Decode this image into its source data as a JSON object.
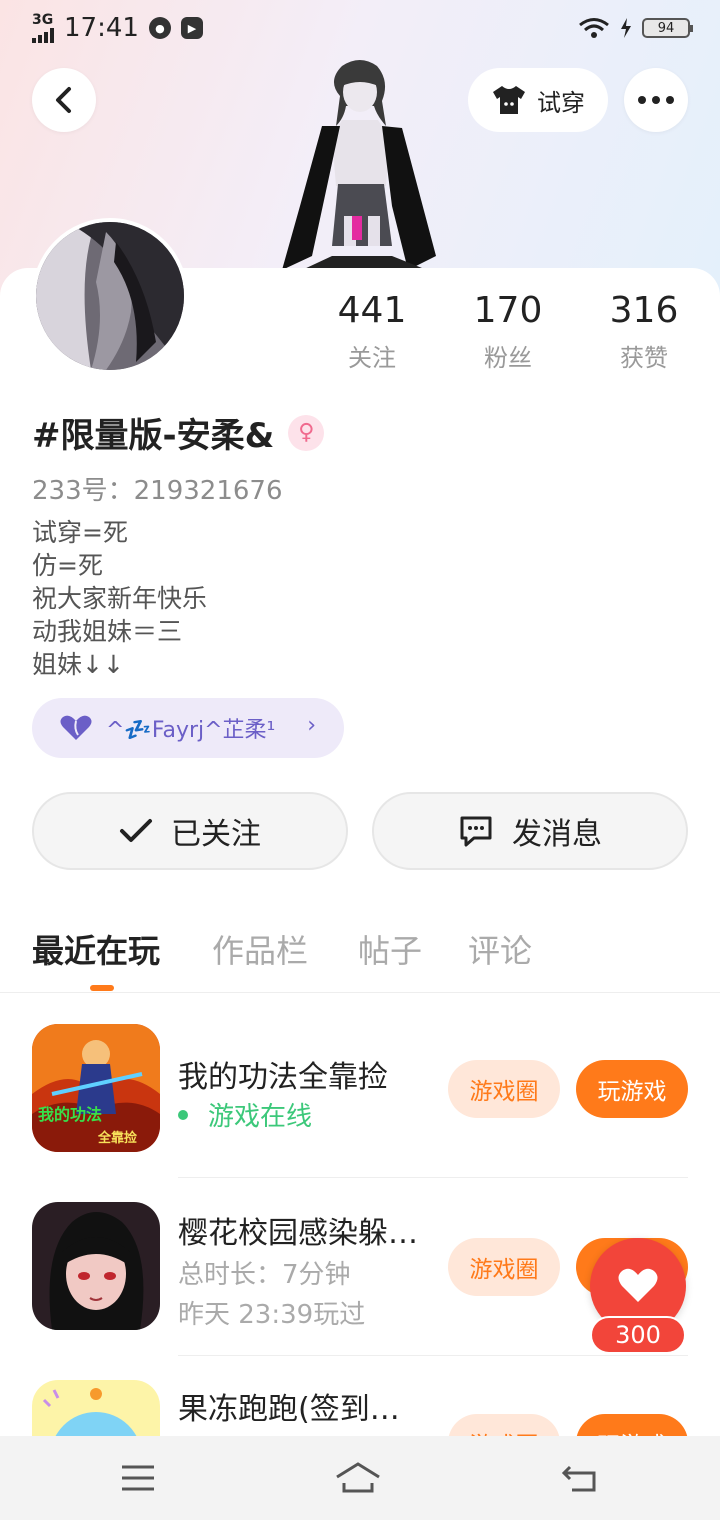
{
  "status_bar": {
    "network": "3G",
    "time": "17:41",
    "battery": "94"
  },
  "header": {
    "tryon_label": "试穿"
  },
  "profile": {
    "stats": [
      {
        "value": "441",
        "label": "关注"
      },
      {
        "value": "170",
        "label": "粉丝"
      },
      {
        "value": "316",
        "label": "获赞"
      }
    ],
    "username": "#限量版-安柔&",
    "gender_symbol": "♀",
    "uid": "233号：219321676",
    "bio_lines": [
      "试穿=死",
      "仿=死",
      "祝大家新年快乐",
      "动我姐妹＝三",
      "姐妹↓↓"
    ],
    "tag_text": "^💤Fayrj^芷柔¹",
    "follow_label": "已关注",
    "message_label": "发消息"
  },
  "tabs": [
    "最近在玩",
    "作品栏",
    "帖子",
    "评论"
  ],
  "games": [
    {
      "name": "我的功法全靠捡",
      "status": "游戏在线",
      "icon_text_1": "我的功法",
      "icon_text_2": "全靠捡",
      "circle_label": "游戏圈",
      "play_label": "玩游戏"
    },
    {
      "name": "樱花校园感染躲…",
      "duration": "总时长：7分钟",
      "last_played": "昨天 23:39玩过",
      "circle_label": "游戏圈"
    },
    {
      "name": "果冻跑跑(签到…",
      "circle_label": "游戏圈",
      "play_label": "玩游戏"
    }
  ],
  "like_count": "300",
  "colors": {
    "accent": "#ff7a1a",
    "online": "#3cc87a",
    "like": "#f2453a",
    "tag": "#6b5fc7"
  },
  "icons": [
    "back-icon",
    "tshirt-icon",
    "more-icon",
    "check-icon",
    "chat-icon",
    "heart-icon",
    "menu-icon",
    "home-icon",
    "return-icon"
  ]
}
